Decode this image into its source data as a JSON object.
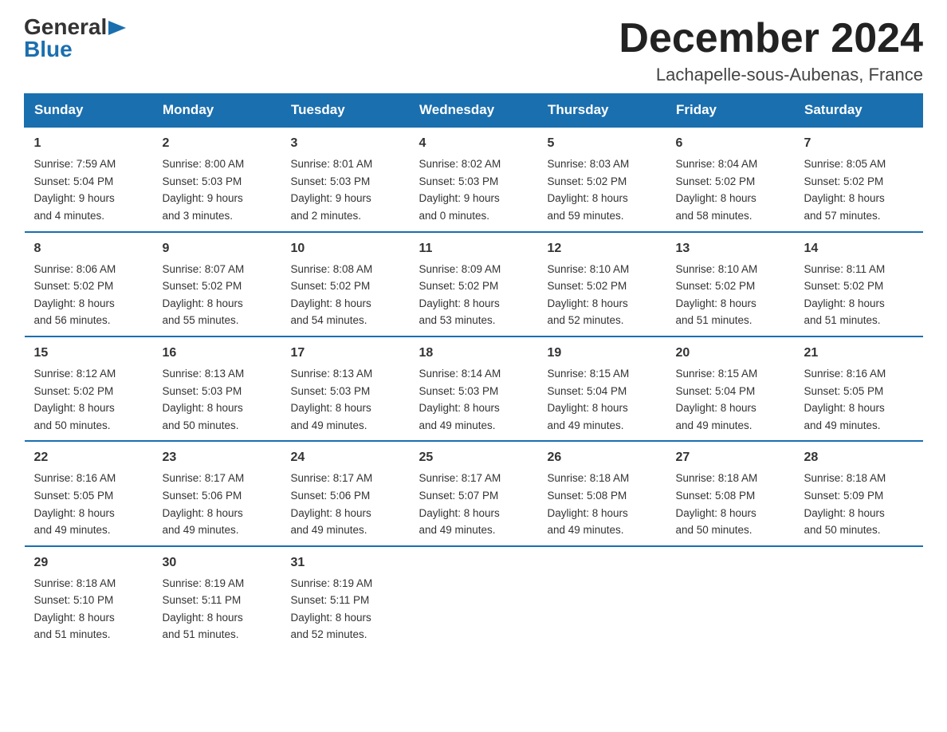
{
  "logo": {
    "general": "General",
    "blue": "Blue",
    "arrow": "▶"
  },
  "title": "December 2024",
  "subtitle": "Lachapelle-sous-Aubenas, France",
  "days_of_week": [
    "Sunday",
    "Monday",
    "Tuesday",
    "Wednesday",
    "Thursday",
    "Friday",
    "Saturday"
  ],
  "weeks": [
    [
      {
        "day": "1",
        "sunrise": "7:59 AM",
        "sunset": "5:04 PM",
        "daylight": "9 hours and 4 minutes."
      },
      {
        "day": "2",
        "sunrise": "8:00 AM",
        "sunset": "5:03 PM",
        "daylight": "9 hours and 3 minutes."
      },
      {
        "day": "3",
        "sunrise": "8:01 AM",
        "sunset": "5:03 PM",
        "daylight": "9 hours and 2 minutes."
      },
      {
        "day": "4",
        "sunrise": "8:02 AM",
        "sunset": "5:03 PM",
        "daylight": "9 hours and 0 minutes."
      },
      {
        "day": "5",
        "sunrise": "8:03 AM",
        "sunset": "5:02 PM",
        "daylight": "8 hours and 59 minutes."
      },
      {
        "day": "6",
        "sunrise": "8:04 AM",
        "sunset": "5:02 PM",
        "daylight": "8 hours and 58 minutes."
      },
      {
        "day": "7",
        "sunrise": "8:05 AM",
        "sunset": "5:02 PM",
        "daylight": "8 hours and 57 minutes."
      }
    ],
    [
      {
        "day": "8",
        "sunrise": "8:06 AM",
        "sunset": "5:02 PM",
        "daylight": "8 hours and 56 minutes."
      },
      {
        "day": "9",
        "sunrise": "8:07 AM",
        "sunset": "5:02 PM",
        "daylight": "8 hours and 55 minutes."
      },
      {
        "day": "10",
        "sunrise": "8:08 AM",
        "sunset": "5:02 PM",
        "daylight": "8 hours and 54 minutes."
      },
      {
        "day": "11",
        "sunrise": "8:09 AM",
        "sunset": "5:02 PM",
        "daylight": "8 hours and 53 minutes."
      },
      {
        "day": "12",
        "sunrise": "8:10 AM",
        "sunset": "5:02 PM",
        "daylight": "8 hours and 52 minutes."
      },
      {
        "day": "13",
        "sunrise": "8:10 AM",
        "sunset": "5:02 PM",
        "daylight": "8 hours and 51 minutes."
      },
      {
        "day": "14",
        "sunrise": "8:11 AM",
        "sunset": "5:02 PM",
        "daylight": "8 hours and 51 minutes."
      }
    ],
    [
      {
        "day": "15",
        "sunrise": "8:12 AM",
        "sunset": "5:02 PM",
        "daylight": "8 hours and 50 minutes."
      },
      {
        "day": "16",
        "sunrise": "8:13 AM",
        "sunset": "5:03 PM",
        "daylight": "8 hours and 50 minutes."
      },
      {
        "day": "17",
        "sunrise": "8:13 AM",
        "sunset": "5:03 PM",
        "daylight": "8 hours and 49 minutes."
      },
      {
        "day": "18",
        "sunrise": "8:14 AM",
        "sunset": "5:03 PM",
        "daylight": "8 hours and 49 minutes."
      },
      {
        "day": "19",
        "sunrise": "8:15 AM",
        "sunset": "5:04 PM",
        "daylight": "8 hours and 49 minutes."
      },
      {
        "day": "20",
        "sunrise": "8:15 AM",
        "sunset": "5:04 PM",
        "daylight": "8 hours and 49 minutes."
      },
      {
        "day": "21",
        "sunrise": "8:16 AM",
        "sunset": "5:05 PM",
        "daylight": "8 hours and 49 minutes."
      }
    ],
    [
      {
        "day": "22",
        "sunrise": "8:16 AM",
        "sunset": "5:05 PM",
        "daylight": "8 hours and 49 minutes."
      },
      {
        "day": "23",
        "sunrise": "8:17 AM",
        "sunset": "5:06 PM",
        "daylight": "8 hours and 49 minutes."
      },
      {
        "day": "24",
        "sunrise": "8:17 AM",
        "sunset": "5:06 PM",
        "daylight": "8 hours and 49 minutes."
      },
      {
        "day": "25",
        "sunrise": "8:17 AM",
        "sunset": "5:07 PM",
        "daylight": "8 hours and 49 minutes."
      },
      {
        "day": "26",
        "sunrise": "8:18 AM",
        "sunset": "5:08 PM",
        "daylight": "8 hours and 49 minutes."
      },
      {
        "day": "27",
        "sunrise": "8:18 AM",
        "sunset": "5:08 PM",
        "daylight": "8 hours and 50 minutes."
      },
      {
        "day": "28",
        "sunrise": "8:18 AM",
        "sunset": "5:09 PM",
        "daylight": "8 hours and 50 minutes."
      }
    ],
    [
      {
        "day": "29",
        "sunrise": "8:18 AM",
        "sunset": "5:10 PM",
        "daylight": "8 hours and 51 minutes."
      },
      {
        "day": "30",
        "sunrise": "8:19 AM",
        "sunset": "5:11 PM",
        "daylight": "8 hours and 51 minutes."
      },
      {
        "day": "31",
        "sunrise": "8:19 AM",
        "sunset": "5:11 PM",
        "daylight": "8 hours and 52 minutes."
      },
      null,
      null,
      null,
      null
    ]
  ],
  "labels": {
    "sunrise": "Sunrise:",
    "sunset": "Sunset:",
    "daylight": "Daylight:"
  }
}
